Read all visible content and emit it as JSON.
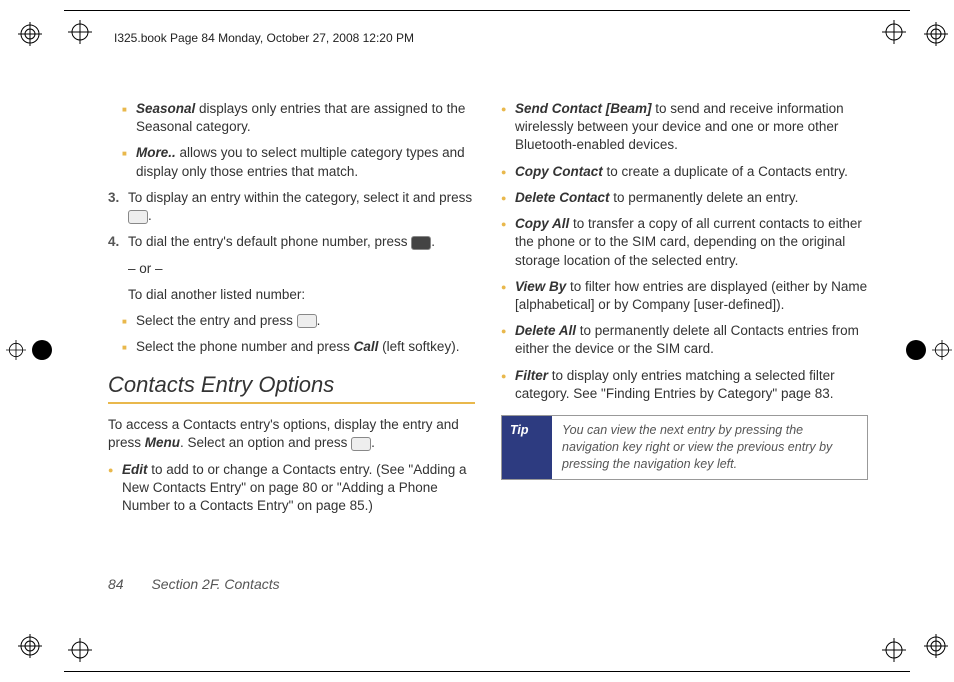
{
  "header": "I325.book  Page 84  Monday, October 27, 2008  12:20 PM",
  "left": {
    "sub": [
      {
        "term": "Seasonal",
        "text": " displays only entries that are assigned to the Seasonal category."
      },
      {
        "term": "More..",
        "text": " allows you to select multiple category types and display only those entries that match."
      }
    ],
    "step3": "To display an entry within the category, select it and press ",
    "step4": "To dial the entry's default phone number, press ",
    "or": "– or –",
    "dialother": "To dial another listed number:",
    "sub2": [
      {
        "text": "Select the entry and press "
      },
      {
        "text": "Select the phone number and press ",
        "tail": " (left softkey)."
      }
    ],
    "call": "Call",
    "sectionTitle": "Contacts Entry Options",
    "intro_a": "To access a Contacts entry's options, display the entry and press ",
    "menu": "Menu",
    "intro_b": ". Select an option and press ",
    "opts": [
      {
        "term": "Edit",
        "text": " to add to or change a Contacts entry. (See \"Adding a New Contacts Entry\" on page 80 or \"Adding a Phone Number to a Contacts Entry\" on page 85.)"
      }
    ]
  },
  "right": {
    "opts": [
      {
        "term": "Send Contact [Beam]",
        "text": " to send and receive information wirelessly between your device and one or more other Bluetooth-enabled devices."
      },
      {
        "term": "Copy Contact",
        "text": " to create a duplicate of a Contacts entry."
      },
      {
        "term": "Delete Contact",
        "text": " to permanently delete an entry."
      },
      {
        "term": "Copy All",
        "text": " to transfer a copy of all current contacts to either the phone or to the SIM card, depending on the original storage location of the selected entry."
      },
      {
        "term": "View By",
        "text": " to filter how entries are displayed (either by Name [alphabetical] or by Company [user-defined])."
      },
      {
        "term": "Delete All",
        "text": " to permanently delete all Contacts entries from either the device or the SIM card."
      },
      {
        "term": "Filter",
        "text": " to display only entries matching a selected filter category. See \"Finding Entries by Category\" page 83."
      }
    ],
    "tipLabel": "Tip",
    "tipBody": "You can view the next entry by pressing the navigation key right or view the previous entry by pressing the navigation key left."
  },
  "footer": {
    "page": "84",
    "section": "Section 2F. Contacts"
  }
}
